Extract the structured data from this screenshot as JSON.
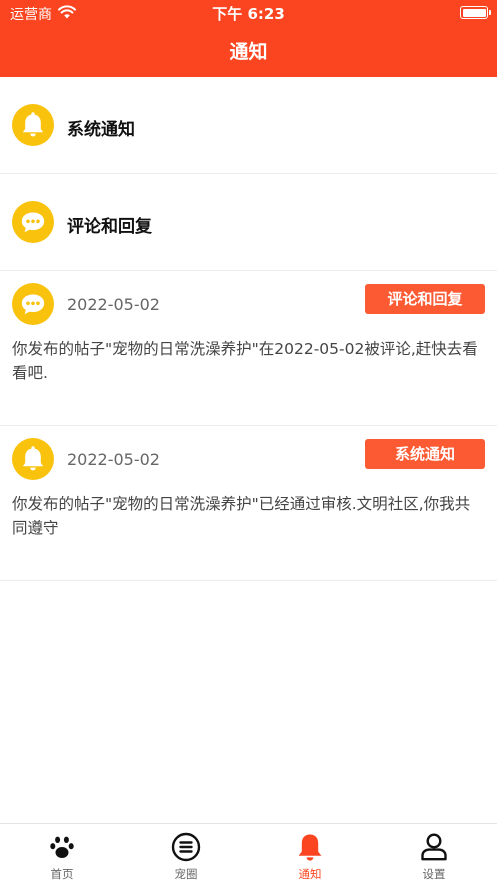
{
  "status_bar": {
    "carrier": "运营商",
    "time": "下午 6:23"
  },
  "header": {
    "title": "通知"
  },
  "categories": [
    {
      "label": "系统通知",
      "icon": "bell-icon"
    },
    {
      "label": "评论和回复",
      "icon": "chat-bubble-icon"
    }
  ],
  "notifications": [
    {
      "date": "2022-05-02",
      "tag": "评论和回复",
      "icon": "chat-bubble-icon",
      "message": "你发布的帖子\"宠物的日常洗澡养护\"在2022-05-02被评论,赶快去看看吧."
    },
    {
      "date": "2022-05-02",
      "tag": "系统通知",
      "icon": "bell-icon",
      "message": "你发布的帖子\"宠物的日常洗澡养护\"已经通过审核.文明社区,你我共同遵守"
    }
  ],
  "tabbar": {
    "items": [
      {
        "label": "首页",
        "icon": "paw-icon"
      },
      {
        "label": "宠圈",
        "icon": "list-circle-icon"
      },
      {
        "label": "通知",
        "icon": "bell-icon",
        "active": true
      },
      {
        "label": "设置",
        "icon": "person-icon"
      }
    ]
  },
  "colors": {
    "brand": "#fb4520",
    "tag": "#fb5a32",
    "icon_bg": "#f9c20d"
  }
}
